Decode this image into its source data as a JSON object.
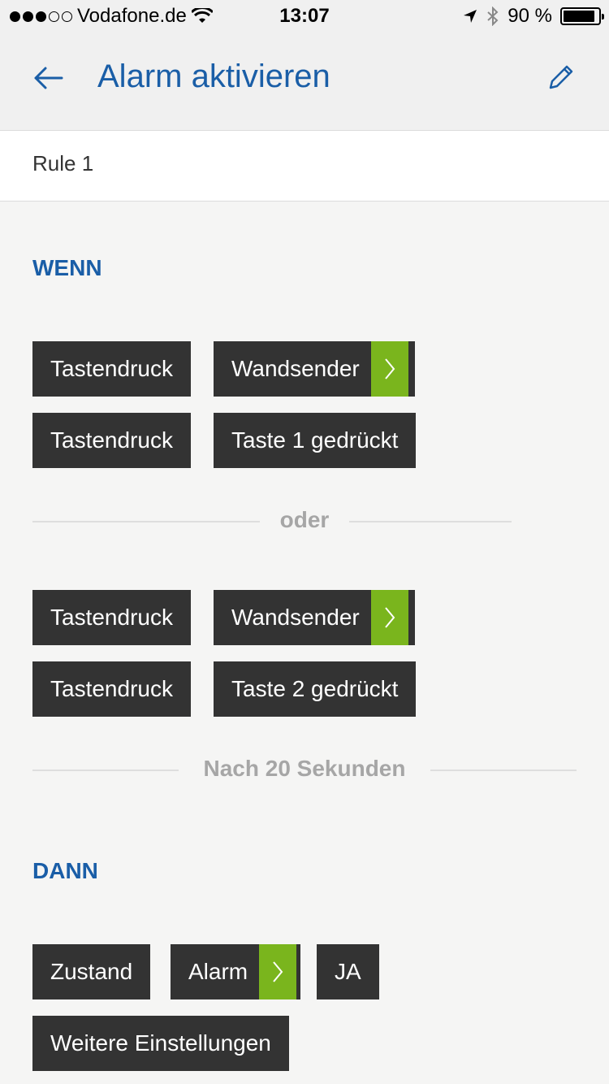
{
  "status_bar": {
    "carrier": "Vodafone.de",
    "time": "13:07",
    "battery": "90 %"
  },
  "header": {
    "title": "Alarm aktivieren"
  },
  "rule": {
    "name": "Rule 1"
  },
  "wenn": {
    "heading": "WENN",
    "group1": {
      "row1": {
        "type": "Tastendruck",
        "device": "Wandsender"
      },
      "row2": {
        "type": "Tastendruck",
        "event": "Taste 1 gedrückt"
      }
    },
    "separator": "oder",
    "group2": {
      "row1": {
        "type": "Tastendruck",
        "device": "Wandsender"
      },
      "row2": {
        "type": "Tastendruck",
        "event": "Taste 2 gedrückt"
      }
    },
    "delay": "Nach 20 Sekunden"
  },
  "dann": {
    "heading": "DANN",
    "state_label": "Zustand",
    "target": "Alarm",
    "value": "JA",
    "more_settings": "Weitere Einstellungen"
  },
  "colors": {
    "accent_blue": "#1a5ea7",
    "chip_dark": "#333333",
    "chip_arrow_green": "#7ab51d",
    "background": "#f5f5f4"
  }
}
